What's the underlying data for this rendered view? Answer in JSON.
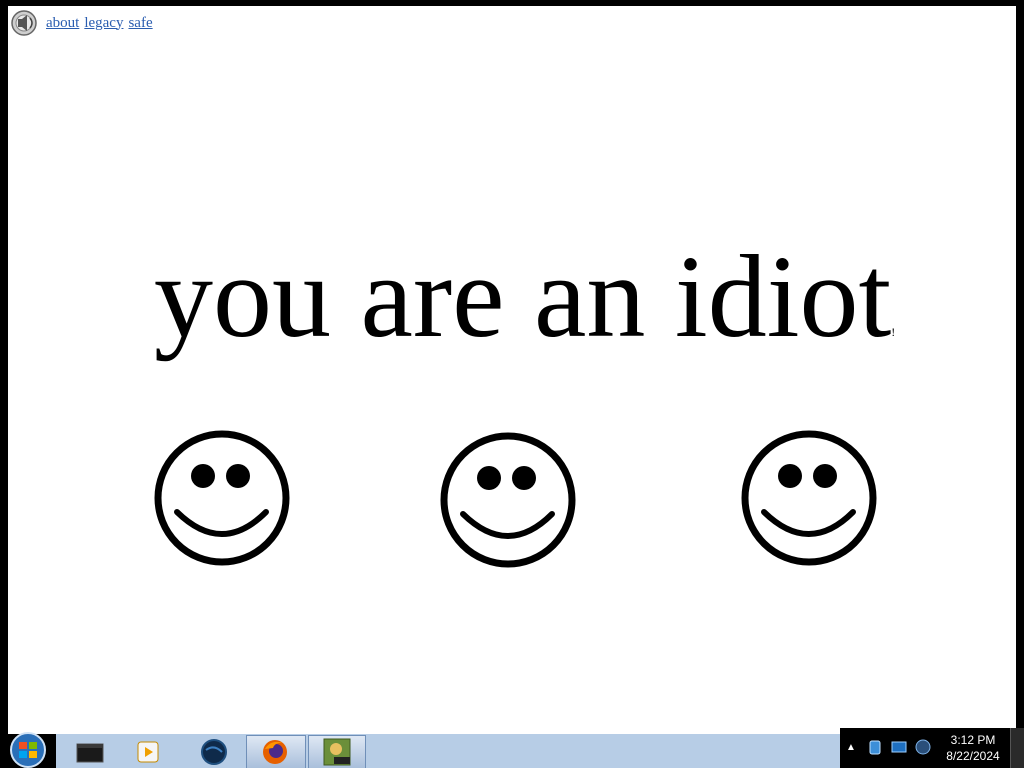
{
  "top_links": [
    {
      "label": "about"
    },
    {
      "label": "legacy"
    },
    {
      "label": "safe"
    }
  ],
  "headline": {
    "text": "you are an idiot",
    "tail": "!"
  },
  "smileys": [
    {
      "icon": "smiley-face-icon"
    },
    {
      "icon": "smiley-face-icon"
    },
    {
      "icon": "smiley-face-icon"
    }
  ],
  "taskbar": {
    "icons": [
      {
        "icon": "windows-start-orb-icon"
      },
      {
        "icon": "terminal-window-icon"
      },
      {
        "icon": "media-player-icon"
      },
      {
        "icon": "globe-browser-icon"
      },
      {
        "icon": "firefox-icon"
      },
      {
        "icon": "game-box-icon"
      }
    ]
  },
  "tray": {
    "time": "3:12 PM",
    "date": "8/22/2024"
  },
  "colors": {
    "link": "#2a5db0",
    "taskbar": "#b7cde6",
    "text": "#000000"
  }
}
